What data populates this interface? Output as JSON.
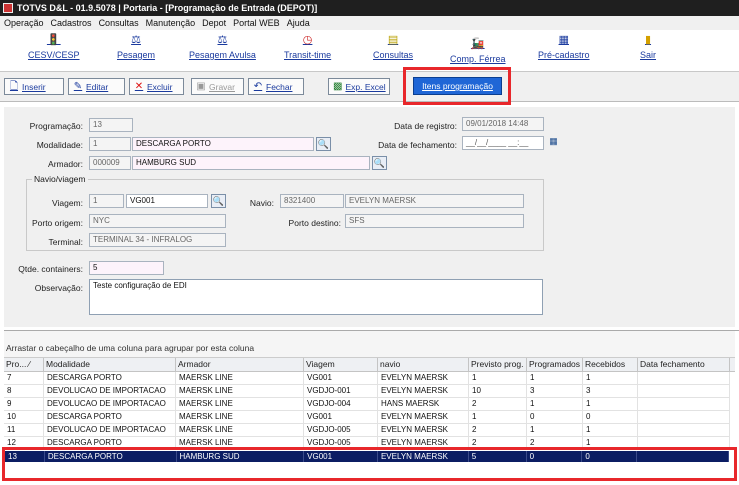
{
  "window": {
    "title": "TOTVS D&L - 01.9.5078 | Portaria - [Programação de Entrada (DEPOT)]"
  },
  "menu": [
    "Operação",
    "Cadastros",
    "Consultas",
    "Manutenção",
    "Depot",
    "Portal WEB",
    "Ajuda"
  ],
  "iconbar": [
    {
      "label": "CESV/CESP",
      "icon": "traffic-light-icon"
    },
    {
      "label": "Pesagem",
      "icon": "scale-icon"
    },
    {
      "label": "Pesagem Avulsa",
      "icon": "scale-icon"
    },
    {
      "label": "Transit-time",
      "icon": "clock-icon"
    },
    {
      "label": "Consultas",
      "icon": "document-icon"
    },
    {
      "label": "Comp. Férrea",
      "icon": "train-icon"
    },
    {
      "label": "Pré-cadastro",
      "icon": "form-icon"
    },
    {
      "label": "Sair",
      "icon": "door-icon"
    }
  ],
  "toolbar": {
    "inserir": "Inserir",
    "editar": "Editar",
    "excluir": "Excluir",
    "gravar": "Gravar",
    "fechar": "Fechar",
    "exp_excel": "Exp. Excel",
    "itens": "Itens programação"
  },
  "form": {
    "programacao_label": "Programação:",
    "programacao": "13",
    "modalidade_label": "Modalidade:",
    "modalidade_code": "1",
    "modalidade": "DESCARGA PORTO",
    "armador_label": "Armador:",
    "armador_code": "000009",
    "armador": "HAMBURG SUD",
    "data_registro_label": "Data de registro:",
    "data_registro": "09/01/2018 14:48",
    "data_fechamento_label": "Data de fechamento:",
    "data_fechamento": "__/__/____ __:__",
    "navio_viagem_label": "Navio/viagem",
    "viagem_label": "Viagem:",
    "viagem_code": "1",
    "viagem": "VG001",
    "navio_label": "Navio:",
    "navio_code": "8321400",
    "navio": "EVELYN MAERSK",
    "porto_origem_label": "Porto origem:",
    "porto_origem": "NYC",
    "porto_destino_label": "Porto destino:",
    "porto_destino": "SFS",
    "terminal_label": "Terminal:",
    "terminal": "TERMINAL 34 - INFRALOG",
    "qtde_label": "Qtde. containers:",
    "qtde": "5",
    "observacao_label": "Observação:",
    "observacao": "Teste configuração de EDI"
  },
  "grid": {
    "hint": "Arrastar o cabeçalho de uma coluna para agrupar por esta coluna",
    "columns": [
      "Pro... ∕",
      "Modalidade",
      "Armador",
      "Viagem",
      "navio",
      "Previsto prog.",
      "Programados",
      "Recebidos",
      "Data fechamento"
    ],
    "rows": [
      [
        "7",
        "DESCARGA PORTO",
        "MAERSK LINE",
        "VG001",
        "EVELYN MAERSK",
        "1",
        "1",
        "1",
        ""
      ],
      [
        "8",
        "DEVOLUCAO DE IMPORTACAO",
        "MAERSK LINE",
        "VGDJO-001",
        "EVELYN MAERSK",
        "10",
        "3",
        "3",
        ""
      ],
      [
        "9",
        "DEVOLUCAO DE IMPORTACAO",
        "MAERSK LINE",
        "VGDJO-004",
        "HANS MAERSK",
        "2",
        "1",
        "1",
        ""
      ],
      [
        "10",
        "DESCARGA PORTO",
        "MAERSK LINE",
        "VG001",
        "EVELYN MAERSK",
        "1",
        "0",
        "0",
        ""
      ],
      [
        "11",
        "DEVOLUCAO DE IMPORTACAO",
        "MAERSK LINE",
        "VGDJO-005",
        "EVELYN MAERSK",
        "2",
        "1",
        "1",
        ""
      ],
      [
        "12",
        "DESCARGA PORTO",
        "MAERSK LINE",
        "VGDJO-005",
        "EVELYN MAERSK",
        "2",
        "2",
        "1",
        ""
      ],
      [
        "13",
        "DESCARGA PORTO",
        "HAMBURG SUD",
        "VG001",
        "EVELYN MAERSK",
        "5",
        "0",
        "0",
        ""
      ]
    ]
  }
}
